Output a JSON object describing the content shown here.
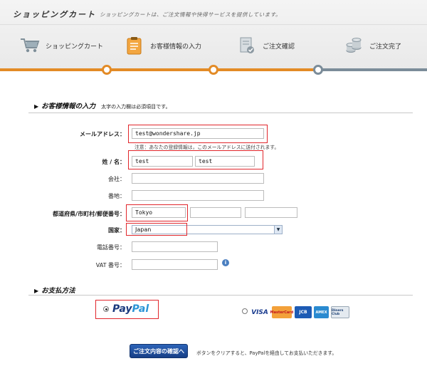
{
  "header": {
    "title": "ショッピングカート",
    "subtitle": "ショッピングカートは、ご注文情報や快得サービスを提供しています。"
  },
  "steps": [
    {
      "label": "ショッピングカート",
      "icon": "cart-icon"
    },
    {
      "label": "お客様情報の入力",
      "icon": "clipboard-icon"
    },
    {
      "label": "ご注文確認",
      "icon": "document-check-icon"
    },
    {
      "label": "ご注文完了",
      "icon": "coins-icon"
    }
  ],
  "progress": {
    "active_color": "#e38b26",
    "inactive_color": "#7b8c99",
    "completed_steps": 3
  },
  "customer_section": {
    "heading": "お客様情報の入力",
    "note": "太字の入力欄は必須項目です。"
  },
  "form": {
    "email_label": "メールアドレス：",
    "email_value": "test@wondershare.jp",
    "email_hint": "注意：あなたの登録情報は，このメールアドレスに送付されます。",
    "name_label": "姓 / 名：",
    "last_name": "test",
    "first_name": "test",
    "company_label": "会社：",
    "address_label": "番地：",
    "location_label": "都道府県/市町村/郵便番号：",
    "prefecture_value": "Tokyo",
    "city_value": "",
    "zip_value": "",
    "country_label": "国家：",
    "country_value": "Japan",
    "phone_label": "電話番号：",
    "vat_label": "VAT 番号："
  },
  "payment_section": {
    "heading": "お支払方法",
    "paypal_part1": "Pay",
    "paypal_part2": "Pal",
    "cards": [
      "VISA",
      "MasterCard",
      "JCB",
      "AMEX",
      "Diners Club"
    ]
  },
  "footer": {
    "button_label": "ご注文内容の確認へ",
    "note": "ボタンをクリアすると、PayPalを経由してお支払いただきます。"
  },
  "highlight_color": "#e1262b"
}
